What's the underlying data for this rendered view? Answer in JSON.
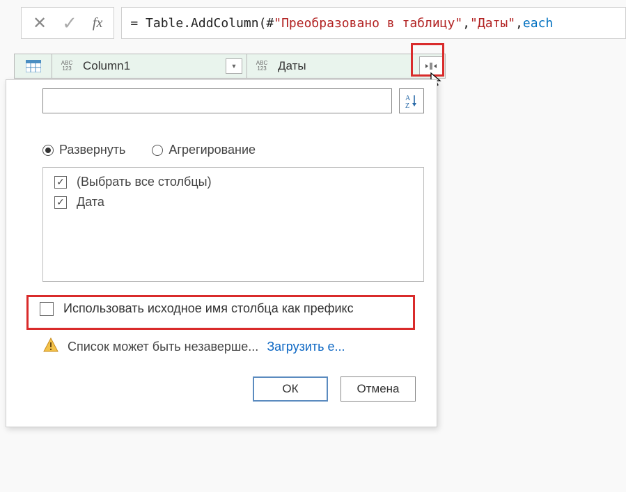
{
  "formula": {
    "prefix": "= Table.AddColumn(#",
    "arg1": "\"Преобразовано в таблицу\"",
    "sep1": ", ",
    "arg2": "\"Даты\"",
    "sep2": ", ",
    "kw": "each"
  },
  "columns": {
    "type_label_top": "ABC",
    "type_label_bottom": "123",
    "col1": "Column1",
    "col2": "Даты"
  },
  "popup": {
    "search_placeholder": "",
    "sort_label": "A↓Z",
    "radios": {
      "expand": "Развернуть",
      "aggregate": "Агрегирование"
    },
    "columns": {
      "select_all": "(Выбрать все столбцы)",
      "items": [
        "Дата"
      ]
    },
    "prefix_checkbox": "Использовать исходное имя столбца как префикс",
    "warning_text": "Список может быть незаверше...",
    "load_more": "Загрузить е...",
    "ok": "ОК",
    "cancel": "Отмена"
  }
}
